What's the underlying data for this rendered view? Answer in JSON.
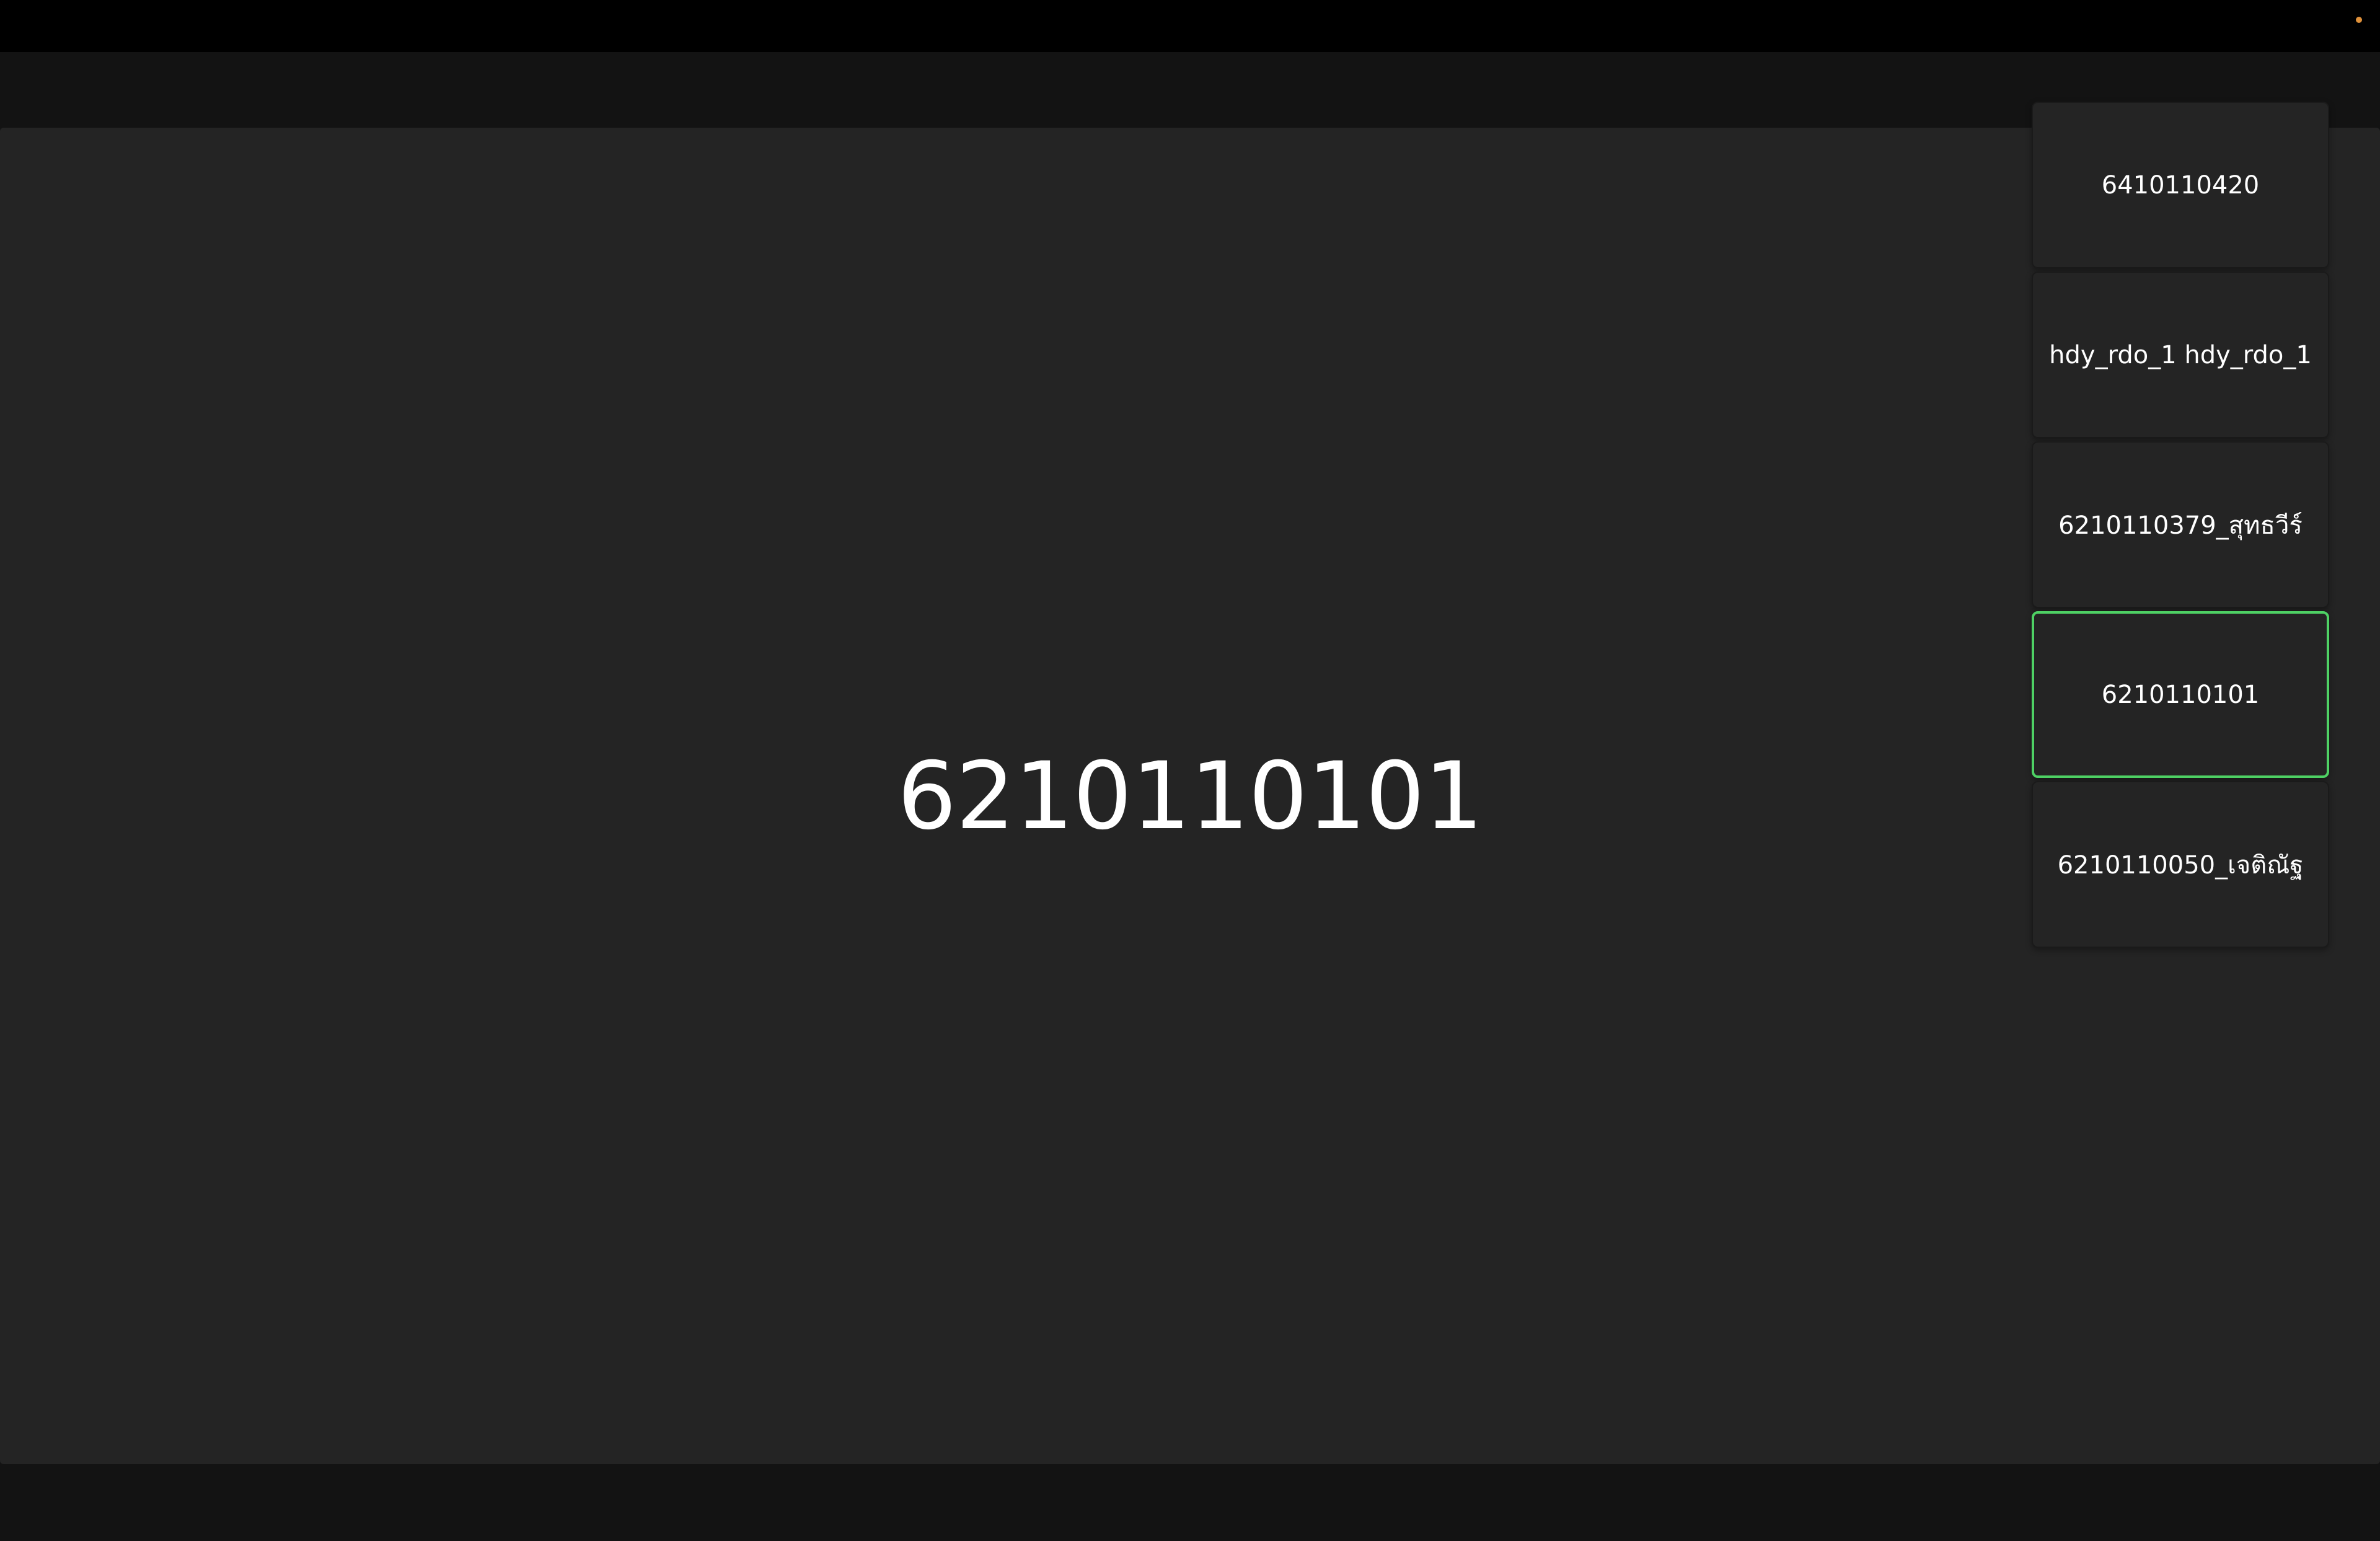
{
  "status": {
    "indicator_color": "#e0913a"
  },
  "stage": {
    "active_speaker": "6210110101"
  },
  "participants": [
    {
      "name": "6410110420",
      "active": false
    },
    {
      "name": "hdy_rdo_1 hdy_rdo_1",
      "active": false
    },
    {
      "name": "6210110379_สุทธวีร์",
      "active": false
    },
    {
      "name": "6210110101",
      "active": true
    },
    {
      "name": "6210110050_เจติณัฐ",
      "active": false
    }
  ],
  "colors": {
    "active_border": "#4ed164",
    "tile_background": "#242424",
    "stage_background": "#242424"
  }
}
